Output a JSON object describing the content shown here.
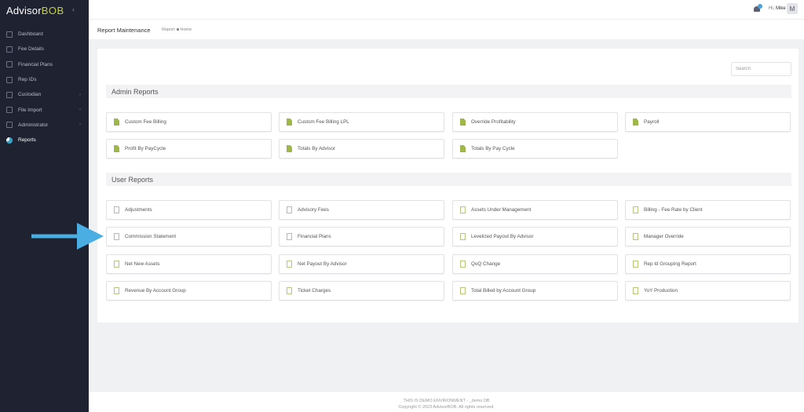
{
  "app": {
    "brand_text": "Advisor",
    "brand_accent": "BOB",
    "collapse_icon": "chevron-left-icon"
  },
  "sidebar": {
    "items": [
      {
        "label": "Dashboard",
        "icon": "home-icon",
        "has_chevron": false,
        "active": false
      },
      {
        "label": "Fee Details",
        "icon": "list-icon",
        "has_chevron": false,
        "active": false
      },
      {
        "label": "Financial Plans",
        "icon": "chart-icon",
        "has_chevron": false,
        "active": false
      },
      {
        "label": "Rep IDs",
        "icon": "id-card-icon",
        "has_chevron": false,
        "active": false
      },
      {
        "label": "Custodian",
        "icon": "grid-icon",
        "has_chevron": true,
        "active": false
      },
      {
        "label": "File Import",
        "icon": "upload-icon",
        "has_chevron": true,
        "active": false
      },
      {
        "label": "Administrator",
        "icon": "gear-icon",
        "has_chevron": true,
        "active": false
      },
      {
        "label": "Reports",
        "icon": "pie-chart-icon",
        "has_chevron": false,
        "active": true
      }
    ]
  },
  "topbar": {
    "notification_icon": "bell-icon",
    "greeting_prefix": "Hi,",
    "user_name": "Mike",
    "avatar_initial": "M"
  },
  "page": {
    "title": "Report Maintenance",
    "breadcrumb_current": "Report",
    "breadcrumb_home": "Home"
  },
  "search": {
    "placeholder": "Search",
    "value": ""
  },
  "admin_reports": {
    "title": "Admin Reports",
    "items": [
      "Custom Fee Billing",
      "Custom Fee Billing LPL",
      "Override Profitability",
      "Payroll",
      "Profit By PayCycle",
      "Totals By Advisor",
      "Totals By Pay Cycle"
    ]
  },
  "user_reports": {
    "title": "User Reports",
    "items": [
      "Adjustments",
      "Advisory Fees",
      "Assets Under Management",
      "Billing - Fee Rate by Client",
      "Commission Statement",
      "Financial Plans",
      "Levelized Payout By Advisor",
      "Manager Override",
      "Net New Assets",
      "Net Payout By Advisor",
      "QoQ Change",
      "Rep Id Grouping Report",
      "Revenue By Account Group",
      "Ticket Charges",
      "Total Billed by Account Group",
      "YoY Production"
    ]
  },
  "annotation": {
    "arrow_color": "#4aaee3",
    "arrow_icon": "arrow-right-icon"
  },
  "footer": {
    "line1": "THIS IS DEMO ENVIRONMENT - _demo DB",
    "line2": "Copyright © 2023 AdvisorBOB. All rights reserved."
  },
  "colors": {
    "sidebar_bg": "#1f2230",
    "brand_accent": "#c6cf3a",
    "doc_icon": "#9fb749",
    "active_icon": "#3aa3c6"
  }
}
